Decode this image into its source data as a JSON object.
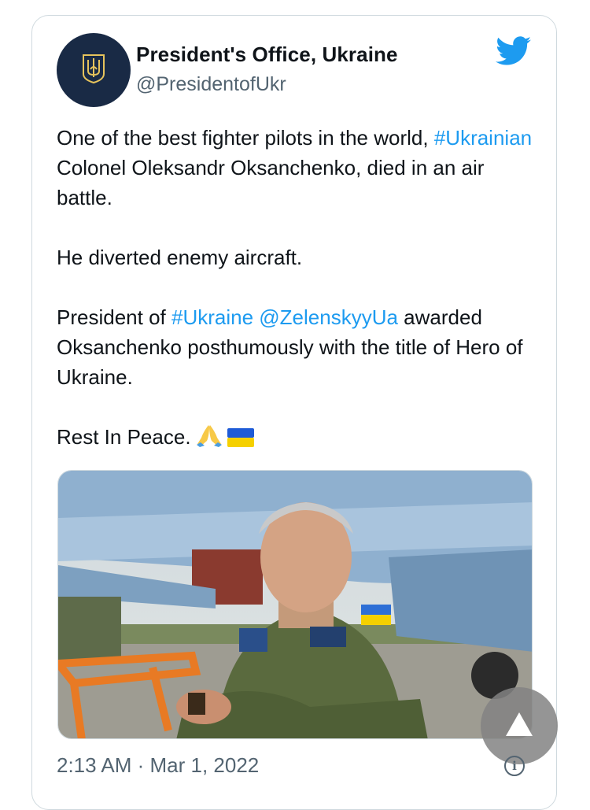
{
  "tweet": {
    "author_name": "President's Office, Ukraine",
    "author_handle": "@PresidentofUkr",
    "avatar_icon": "trident-icon",
    "brand_icon": "twitter-bird-icon",
    "para1": {
      "pre": "One of the best fighter pilots in the world, ",
      "hashtag": "#Ukrainian",
      "post": " Colonel Oleksandr Oksanchenko, died in an air battle."
    },
    "para2": "He diverted enemy aircraft.",
    "para3": {
      "pre": "President of ",
      "hashtag": "#Ukraine",
      "space": " ",
      "mention": "@ZelenskyyUa",
      "post": " awarded Oksanchenko posthumously with the title of Hero of Ukraine."
    },
    "para4": {
      "text": "Rest In Peace.",
      "emojis": [
        "folded-hands-icon",
        "ukraine-flag-icon"
      ]
    },
    "media_alt": "pilot-photo",
    "timestamp": "2:13 AM · Mar 1, 2022"
  },
  "colors": {
    "link": "#1d9bf0",
    "avatar_bg": "#192a45",
    "trident": "#e6c35c",
    "muted": "#536471"
  }
}
